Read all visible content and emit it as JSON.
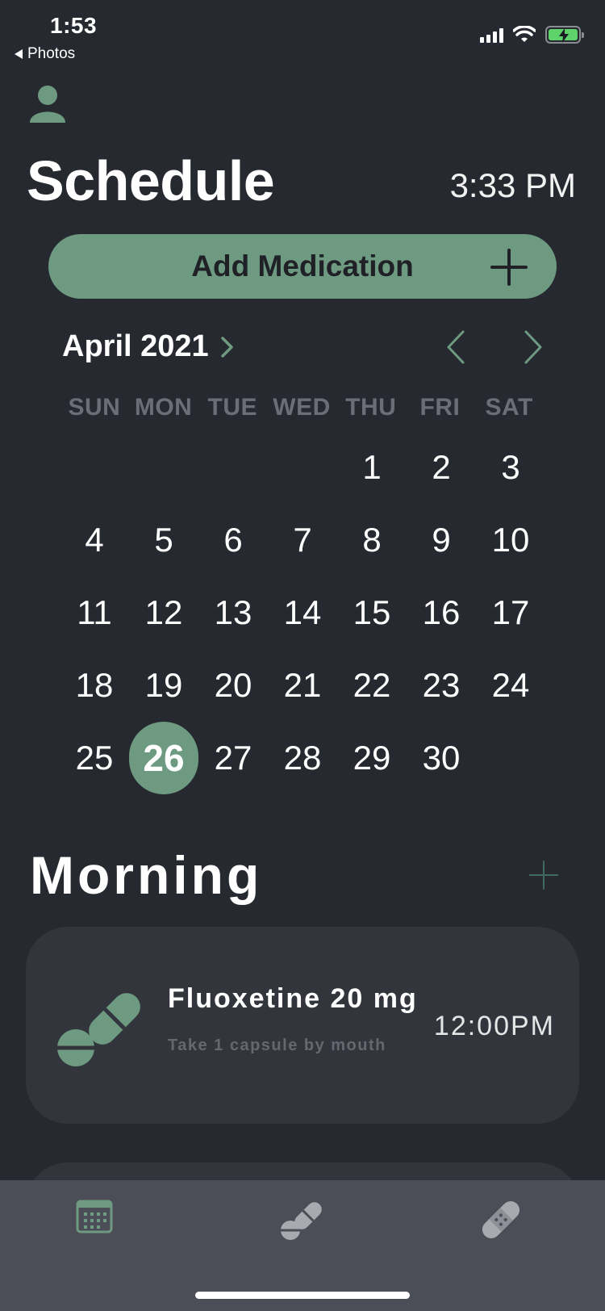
{
  "status_bar": {
    "time": "1:53",
    "back_label": "Photos"
  },
  "header": {
    "title": "Schedule",
    "clock": "3:33 PM"
  },
  "add_button": {
    "label": "Add Medication"
  },
  "calendar": {
    "month_label": "April 2021",
    "weekdays": [
      "SUN",
      "MON",
      "TUE",
      "WED",
      "THU",
      "FRI",
      "SAT"
    ],
    "days": [
      "",
      "",
      "",
      "",
      "1",
      "2",
      "3",
      "4",
      "5",
      "6",
      "7",
      "8",
      "9",
      "10",
      "11",
      "12",
      "13",
      "14",
      "15",
      "16",
      "17",
      "18",
      "19",
      "20",
      "21",
      "22",
      "23",
      "24",
      "25",
      "26",
      "27",
      "28",
      "29",
      "30",
      ""
    ],
    "selected_day": "26"
  },
  "section": {
    "title": "Morning"
  },
  "medications": [
    {
      "name": "Fluoxetine 20 mg",
      "instructions": "Take 1 capsule by mouth",
      "time": "12:00PM"
    }
  ],
  "colors": {
    "accent": "#6d9a80",
    "background": "#272930",
    "card": "#33353d",
    "tabbar": "#4c4e57"
  },
  "icons": {
    "avatar": "person-icon",
    "tab_schedule": "calendar-icon",
    "tab_meds": "pills-icon",
    "tab_other": "bandage-icon"
  }
}
